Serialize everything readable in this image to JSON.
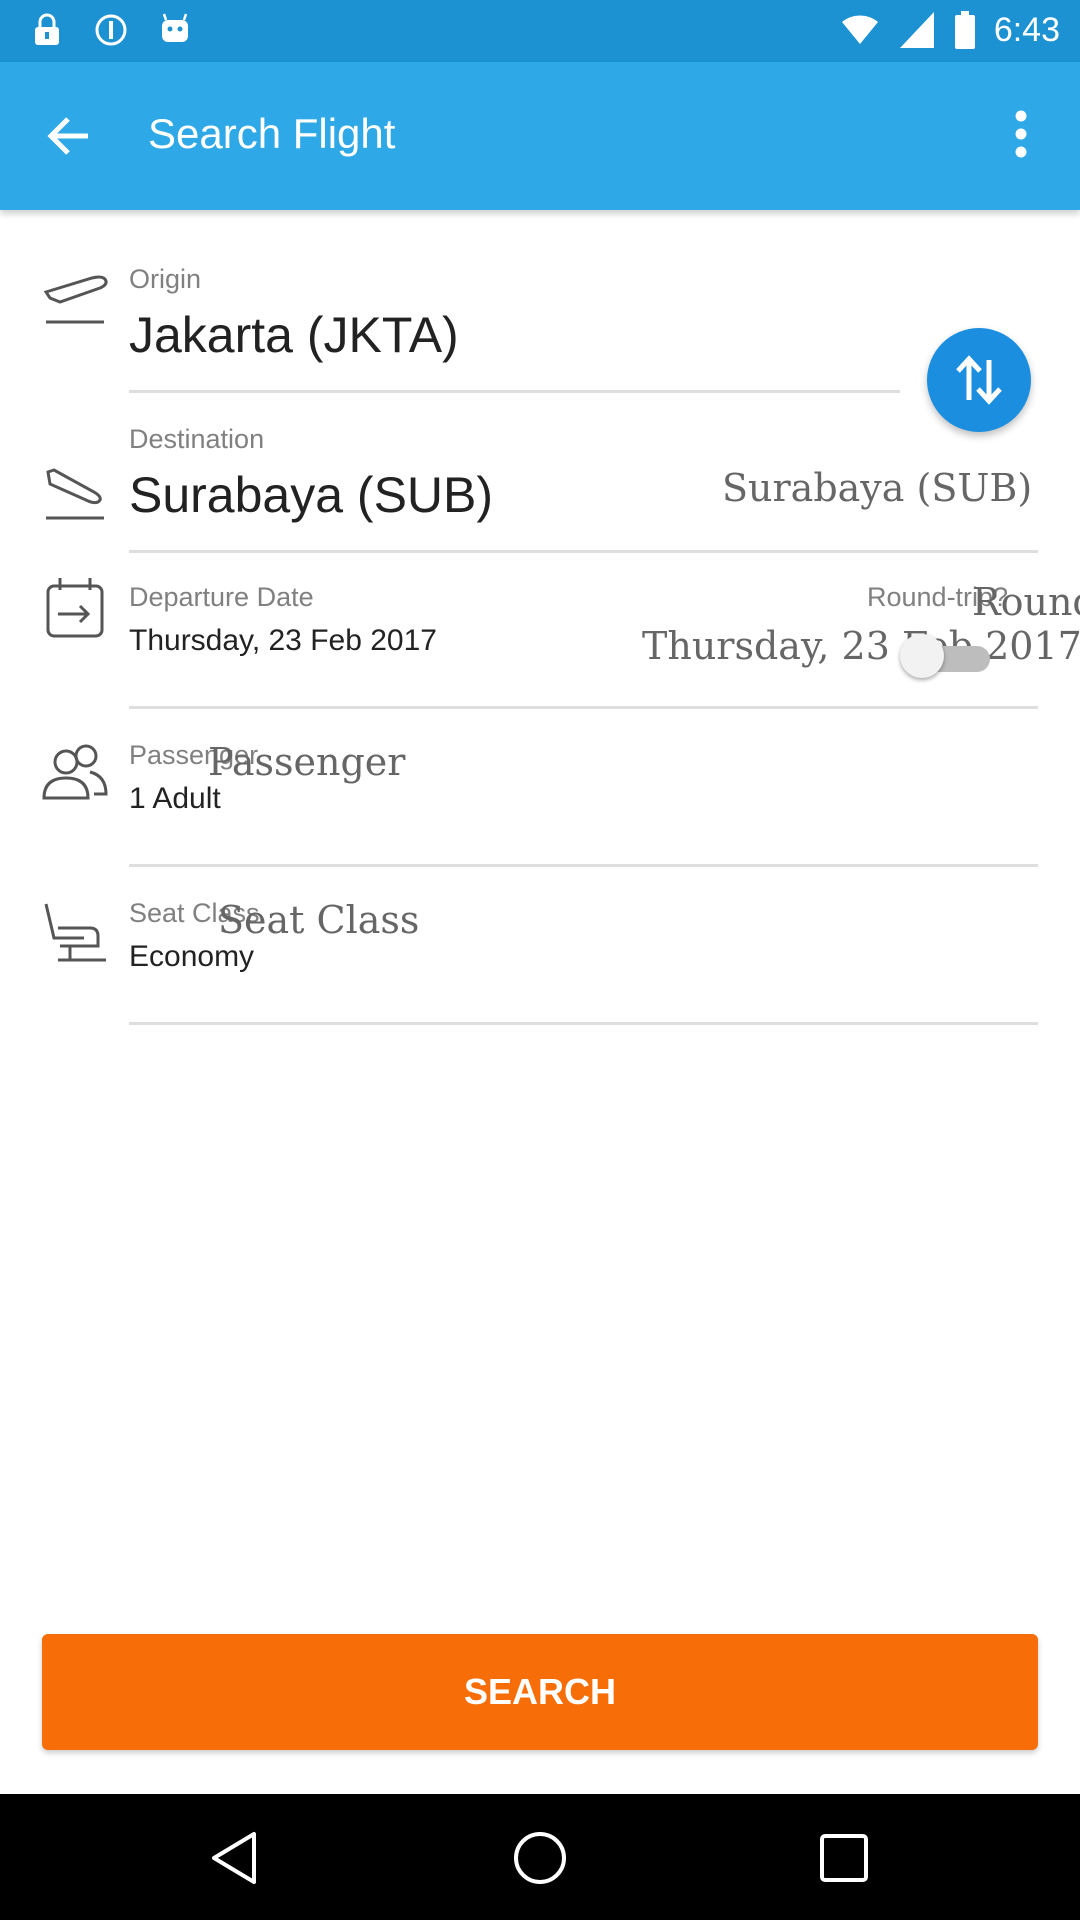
{
  "status_bar": {
    "time": "6:43",
    "icons": [
      "lock-icon",
      "info-icon",
      "android-icon",
      "wifi-icon",
      "signal-icon",
      "battery-icon"
    ]
  },
  "app_bar": {
    "title": "Search Flight",
    "back_icon": "back-arrow-icon",
    "menu_icon": "more-vert-icon"
  },
  "form": {
    "origin": {
      "label": "Origin",
      "value": "Jakarta (JKTA)",
      "icon": "takeoff-icon"
    },
    "destination": {
      "label": "Destination",
      "value": "Surabaya (SUB)",
      "overlay": "Surabaya (SUB)",
      "icon": "landing-icon"
    },
    "departure": {
      "label": "Departure Date",
      "value": "Thursday, 23 Feb 2017",
      "overlay": "Thursday, 23 Feb 2017",
      "icon": "calendar-icon"
    },
    "round_trip": {
      "label": "Round-trip?",
      "overlay": "Round",
      "enabled": false
    },
    "passenger": {
      "label": "Passenger",
      "value": "1 Adult",
      "overlay": "Passenger",
      "icon": "people-icon"
    },
    "seat_class": {
      "label": "Seat Class",
      "value": "Economy",
      "overlay": "Seat Class",
      "icon": "seat-icon"
    }
  },
  "swap_button": {
    "icon": "swap-vertical-icon"
  },
  "search_button": {
    "label": "SEARCH"
  },
  "nav_bar": {
    "icons": [
      "nav-back-icon",
      "nav-home-icon",
      "nav-recents-icon"
    ]
  },
  "colors": {
    "status_bar": "#1c92d2",
    "app_bar": "#2ea8e6",
    "swap_button": "#1c8ee0",
    "search_button": "#f76d08"
  }
}
